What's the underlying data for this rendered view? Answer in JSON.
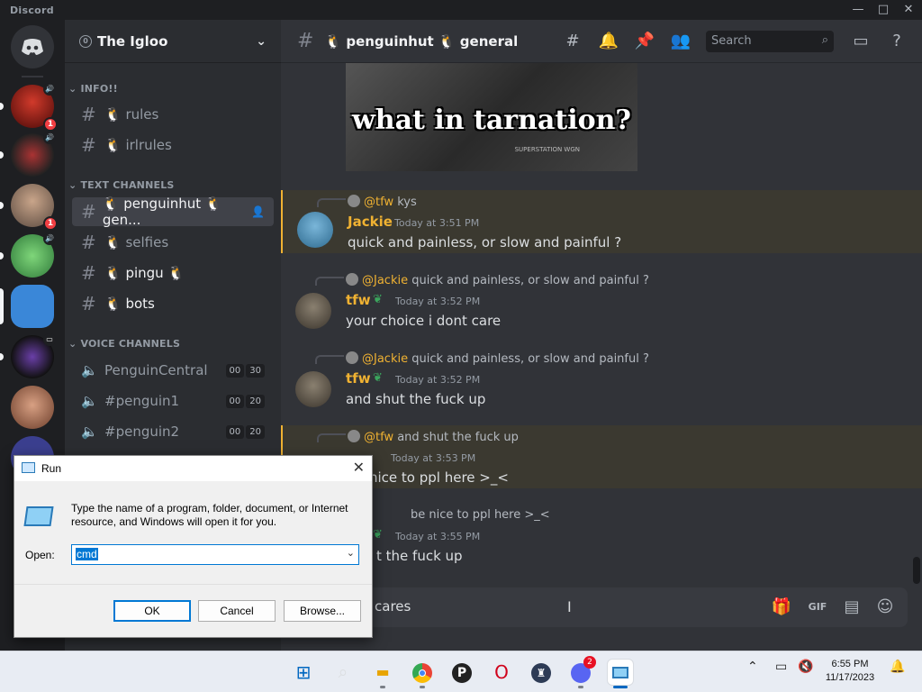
{
  "window": {
    "app": "Discord",
    "min": "—",
    "max": "□",
    "close": "✕"
  },
  "server": {
    "name": "The Igloo",
    "level": "0"
  },
  "rail": {
    "badges": [
      "1",
      "1"
    ]
  },
  "categories": {
    "info": "INFO!!",
    "text": "TEXT CHANNELS",
    "voice": "VOICE CHANNELS"
  },
  "info_channels": [
    "🐧 rules",
    "🐧 irlrules"
  ],
  "text_channels": [
    "🐧 penguinhut 🐧 gen...",
    "🐧 selfies",
    "🐧 pingu 🐧",
    "🐧 bots"
  ],
  "voice_channels": [
    {
      "name": "PenguinCentral",
      "t1": "00",
      "t2": "30"
    },
    {
      "name": "#penguin1",
      "t1": "00",
      "t2": "20"
    },
    {
      "name": "#penguin2",
      "t1": "00",
      "t2": "20"
    }
  ],
  "header": {
    "channel": "🐧 penguinhut 🐧 general",
    "search_placeholder": "Search"
  },
  "gif": {
    "caption": "what in tarnation?",
    "watermark": "SUPERSTATION WGN"
  },
  "messages": [
    {
      "reply_at": "@tfw",
      "reply_text": "kys",
      "user": "Jackie",
      "time": "Today at 3:51 PM",
      "body": "quick and painless, or slow and painful ?"
    },
    {
      "reply_at": "@Jackie",
      "reply_text": "quick and painless, or slow and painful ?",
      "user": "tfw",
      "time": "Today at 3:52 PM",
      "body": "your choice i dont care"
    },
    {
      "reply_at": "@Jackie",
      "reply_text": "quick and painless, or slow and painful ?",
      "user": "tfw",
      "time": "Today at 3:52 PM",
      "body": "and shut the fuck up"
    },
    {
      "reply_at": "@tfw",
      "reply_text": "and shut the fuck up",
      "user": "",
      "time": "Today at 3:53 PM",
      "body": "nice to ppl here >_<"
    },
    {
      "reply_at": "",
      "reply_text": "be nice to ppl here >_<",
      "user": "",
      "time": "Today at 3:55 PM",
      "body": "t the fuck up"
    }
  ],
  "composer": {
    "text": "cares",
    "gif_label": "GIF"
  },
  "run_dialog": {
    "title": "Run",
    "description": "Type the name of a program, folder, document, or Internet resource, and Windows will open it for you.",
    "open_label": "Open:",
    "open_value": "cmd",
    "ok": "OK",
    "cancel": "Cancel",
    "browse": "Browse..."
  },
  "taskbar": {
    "time": "6:55 PM",
    "date": "11/17/2023",
    "discord_badge": "2"
  }
}
